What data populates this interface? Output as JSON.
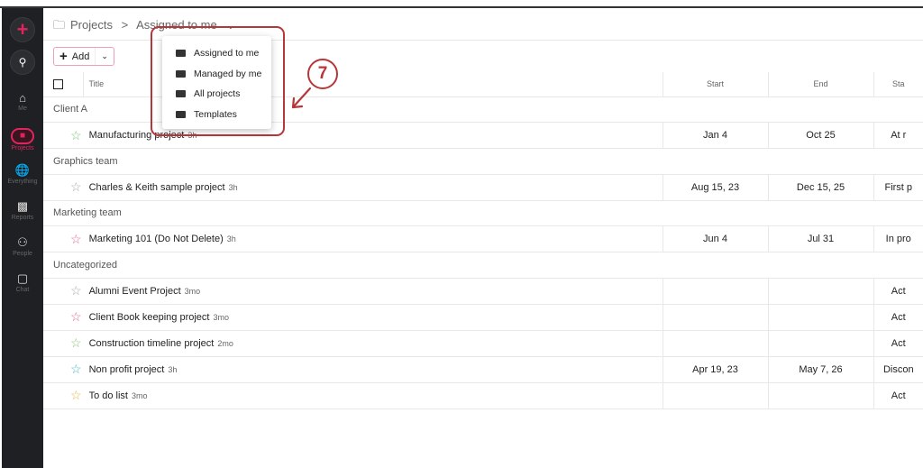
{
  "sidebar": {
    "items": [
      {
        "label": "Me",
        "icon": "home-icon"
      },
      {
        "label": "Projects",
        "icon": "folder-icon",
        "active": true
      },
      {
        "label": "Everything",
        "icon": "globe-icon"
      },
      {
        "label": "Reports",
        "icon": "bar-chart-icon"
      },
      {
        "label": "People",
        "icon": "people-icon"
      },
      {
        "label": "Chat",
        "icon": "chat-icon"
      }
    ]
  },
  "breadcrumb": {
    "root": "Projects",
    "separator": ">",
    "current": "Assigned to me"
  },
  "toolbar": {
    "add_label": "Add"
  },
  "table": {
    "headers": {
      "title": "Title",
      "start": "Start",
      "end": "End",
      "status": "Sta"
    },
    "groups": [
      {
        "name": "Client A",
        "rows": [
          {
            "title": "Manufacturing project",
            "age": "3h",
            "start": "Jan 4",
            "end": "Oct 25",
            "status": "At r",
            "star": "#7cc47f"
          }
        ]
      },
      {
        "name": "Graphics team",
        "rows": [
          {
            "title": "Charles & Keith sample project",
            "age": "3h",
            "start": "Aug 15, 23",
            "end": "Dec 15, 25",
            "status": "First p",
            "star": "#aaaaaa"
          }
        ]
      },
      {
        "name": "Marketing team",
        "rows": [
          {
            "title": "Marketing 101 (Do Not Delete)",
            "age": "3h",
            "start": "Jun 4",
            "end": "Jul 31",
            "status": "In pro",
            "star": "#e06a8a"
          }
        ]
      },
      {
        "name": "Uncategorized",
        "rows": [
          {
            "title": "Alumni Event Project",
            "age": "3mo",
            "start": "",
            "end": "",
            "status": "Act",
            "star": "#aaaaaa"
          },
          {
            "title": "Client Book keeping project",
            "age": "3mo",
            "start": "",
            "end": "",
            "status": "Act",
            "star": "#e06a8a"
          },
          {
            "title": "Construction timeline project",
            "age": "2mo",
            "start": "",
            "end": "",
            "status": "Act",
            "star": "#8cc47f"
          },
          {
            "title": "Non profit project",
            "age": "3h",
            "start": "Apr 19, 23",
            "end": "May 7, 26",
            "status": "Discon",
            "star": "#4bb8c8"
          },
          {
            "title": "To do list",
            "age": "3mo",
            "start": "",
            "end": "",
            "status": "Act",
            "star": "#e8b84a"
          }
        ]
      }
    ]
  },
  "dropdown": {
    "items": [
      "Assigned to me",
      "Managed by me",
      "All projects",
      "Templates"
    ]
  },
  "annotation": {
    "step": "7",
    "color": "#b5373a"
  },
  "colors": {
    "accent": "#e0245e"
  }
}
